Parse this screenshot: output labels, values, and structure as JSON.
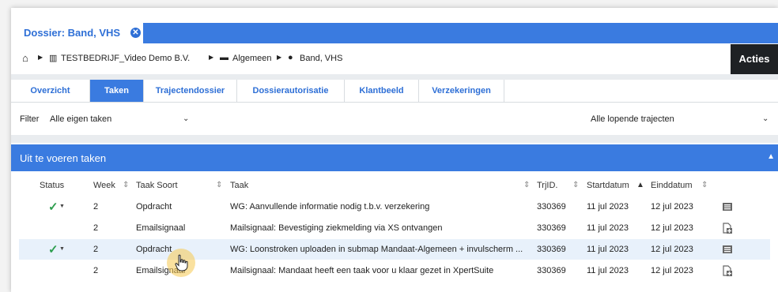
{
  "dossier": {
    "title": "Dossier: Band, VHS",
    "close_icon": "close-icon"
  },
  "breadcrumb": {
    "home_icon": "home-icon",
    "items": [
      {
        "icon": "building-icon",
        "label": "TESTBEDRIJF_Video Demo B.V."
      },
      {
        "icon": "briefcase-icon",
        "label": "Algemeen"
      },
      {
        "icon": "user-icon",
        "label": "Band, VHS"
      }
    ]
  },
  "actions_label": "Acties",
  "tabs": [
    {
      "label": "Overzicht",
      "active": false
    },
    {
      "label": "Taken",
      "active": true
    },
    {
      "label": "Trajectendossier",
      "active": false
    },
    {
      "label": "Dossierautorisatie",
      "active": false
    },
    {
      "label": "Klantbeeld",
      "active": false
    },
    {
      "label": "Verzekeringen",
      "active": false
    }
  ],
  "filter": {
    "label": "Filter",
    "value": "Alle eigen taken",
    "trajecten_value": "Alle lopende trajecten"
  },
  "section": {
    "title": "Uit te voeren taken"
  },
  "columns": {
    "status": "Status",
    "week": "Week",
    "type": "Taak Soort",
    "task": "Taak",
    "trjid": "TrjID.",
    "start": "Startdatum",
    "end": "Einddatum"
  },
  "rows": [
    {
      "status": "check",
      "week": "2",
      "type": "Opdracht",
      "task": "WG: Aanvullende informatie nodig t.b.v. verzekering",
      "trjid": "330369",
      "start": "11 jul 2023",
      "end": "12 jul 2023",
      "icon": "list-icon"
    },
    {
      "status": "",
      "week": "2",
      "type": "Emailsignaal",
      "task": "Mailsignaal: Bevestiging ziekmelding via XS ontvangen",
      "trjid": "330369",
      "start": "11 jul 2023",
      "end": "12 jul 2023",
      "icon": "document-add-icon"
    },
    {
      "status": "check",
      "week": "2",
      "type": "Opdracht",
      "task": "WG: Loonstroken uploaden in submap Mandaat-Algemeen + invulscherm ...",
      "trjid": "330369",
      "start": "11 jul 2023",
      "end": "12 jul 2023",
      "icon": "list-icon"
    },
    {
      "status": "",
      "week": "2",
      "type": "Emailsignaal",
      "task": "Mailsignaal: Mandaat heeft een taak voor u klaar gezet in XpertSuite",
      "trjid": "330369",
      "start": "11 jul 2023",
      "end": "12 jul 2023",
      "icon": "document-add-icon"
    }
  ],
  "colors": {
    "accent": "#3a7be0",
    "link": "#2e6fd6",
    "check": "#2e9e4f",
    "actions_bg": "#1e2124",
    "highlight_row": "#e8f1fb"
  }
}
